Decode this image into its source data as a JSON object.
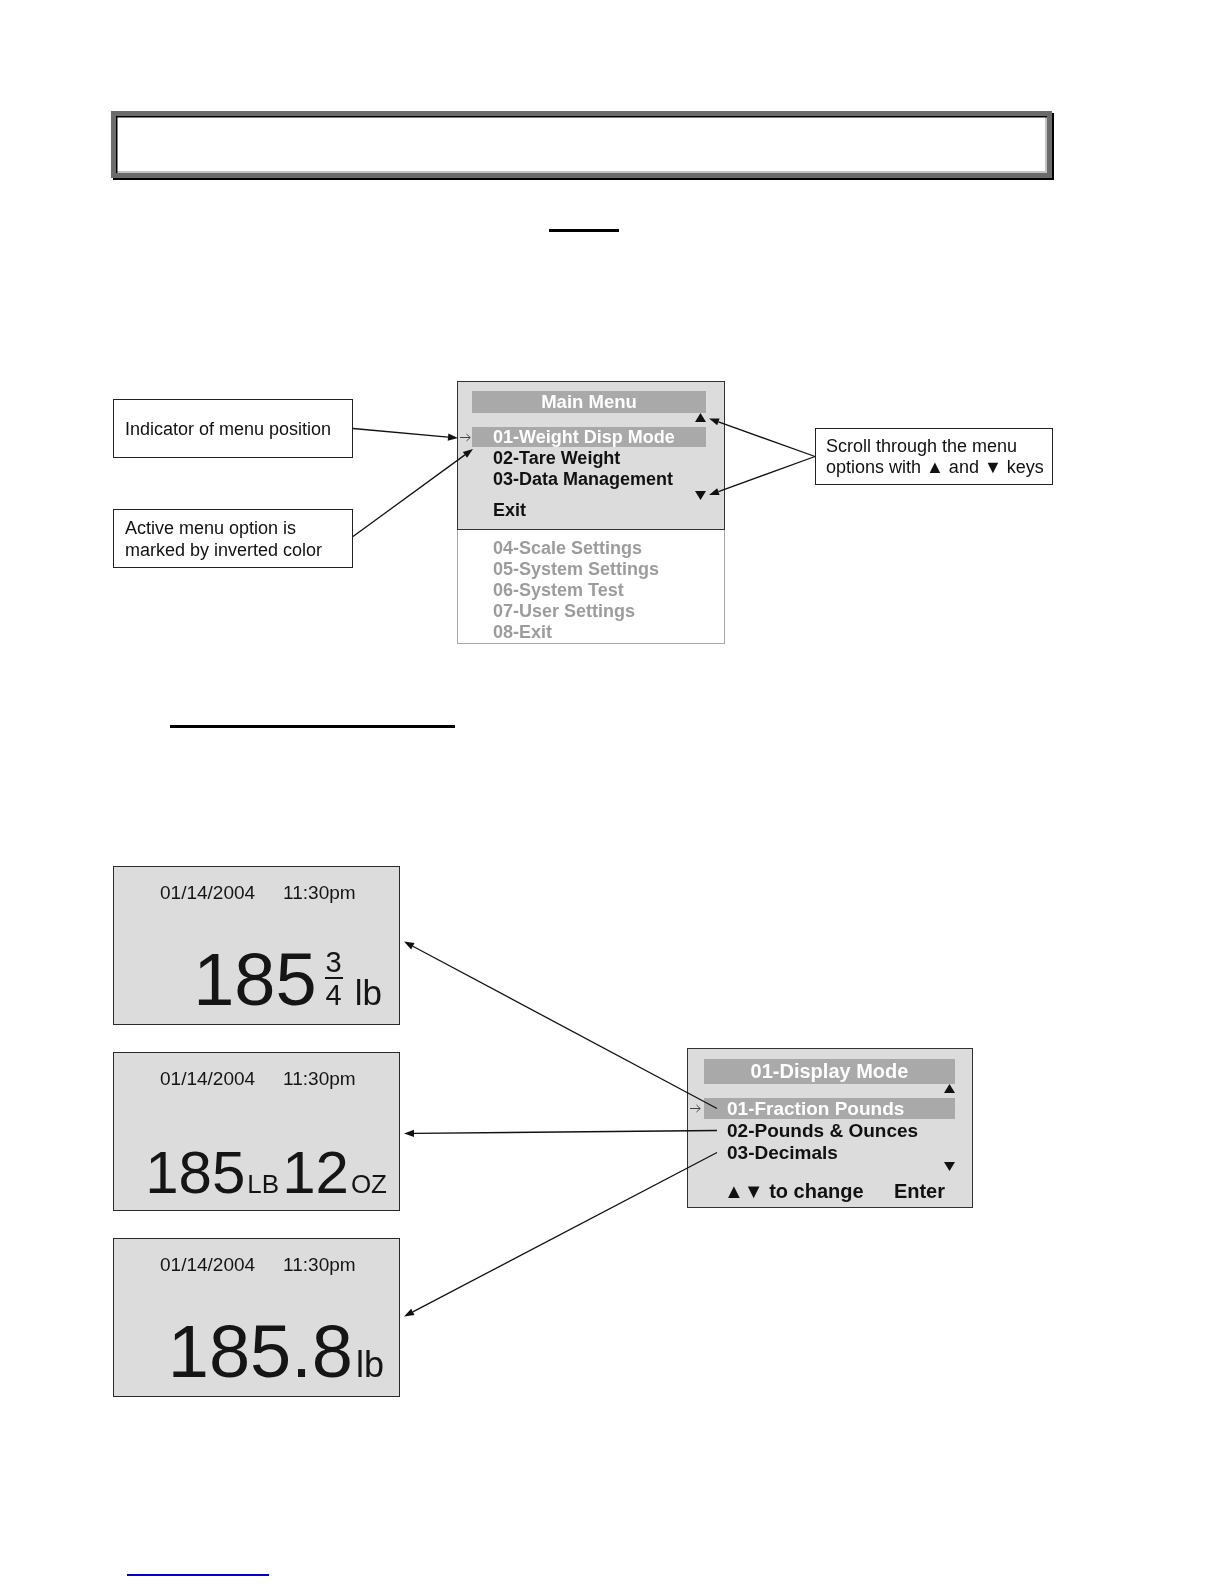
{
  "menu_diagram": {
    "left_callouts": [
      "Indicator of menu position",
      "Active menu option is marked by inverted color"
    ],
    "menu": {
      "title": "Main Menu",
      "items": [
        {
          "label": "01-Weight Disp Mode",
          "selected": true
        },
        {
          "label": "02-Tare Weight",
          "selected": false
        },
        {
          "label": "03-Data Management",
          "selected": false
        }
      ],
      "exit_label": "Exit",
      "items_below_screen": [
        "04-Scale Settings",
        "05-System Settings",
        "06-System Test",
        "07-User Settings",
        "08-Exit"
      ]
    },
    "right_callouts": [
      "Scroll through the menu options with ▲ and ▼ keys"
    ]
  },
  "display_diagram": {
    "displays": [
      {
        "kind": "fraction",
        "date": "01/14/2004",
        "time": "11:30pm",
        "whole": "185",
        "numerator": "3",
        "denominator": "4",
        "unit": "lb"
      },
      {
        "kind": "pounds_ounces",
        "date": "01/14/2004",
        "time": "11:30pm",
        "pounds": "185",
        "pounds_unit": "LB",
        "ounces": "12",
        "ounces_unit": "OZ"
      },
      {
        "kind": "decimal",
        "date": "01/14/2004",
        "time": "11:30pm",
        "value": "185.8",
        "unit": "lb"
      }
    ],
    "menu": {
      "title": "01-Display Mode",
      "items": [
        {
          "label": "01-Fraction Pounds",
          "selected": true
        },
        {
          "label": "02-Pounds & Ounces",
          "selected": false
        },
        {
          "label": "03-Decimals",
          "selected": false
        }
      ],
      "hint": "▲▼ to change",
      "action": "Enter"
    }
  }
}
